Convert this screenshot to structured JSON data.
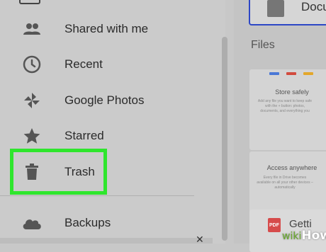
{
  "sidebar": {
    "items": [
      {
        "label": "Shared with me",
        "icon": "people-icon"
      },
      {
        "label": "Recent",
        "icon": "clock-icon"
      },
      {
        "label": "Google Photos",
        "icon": "pinwheel-icon"
      },
      {
        "label": "Starred",
        "icon": "star-icon"
      },
      {
        "label": "Trash",
        "icon": "trash-icon"
      },
      {
        "label": "Backups",
        "icon": "cloud-icon"
      }
    ]
  },
  "main": {
    "top_card_text": "Docu",
    "files_heading": "Files",
    "cards": [
      {
        "title": "Store safely",
        "body": "Add any file you want to keep safe with the + button: photos, documents, and everything you"
      },
      {
        "title": "Access anywhere",
        "body": "Every file in Drive becomes available on all your other devices – automatically"
      },
      {
        "title": "Getti",
        "icon_text": "PDF"
      }
    ]
  },
  "watermark": {
    "prefix": "wiki",
    "suffix": "How"
  },
  "colors": {
    "highlight": "#2fe62d",
    "selected_border": "#2d47c6"
  }
}
